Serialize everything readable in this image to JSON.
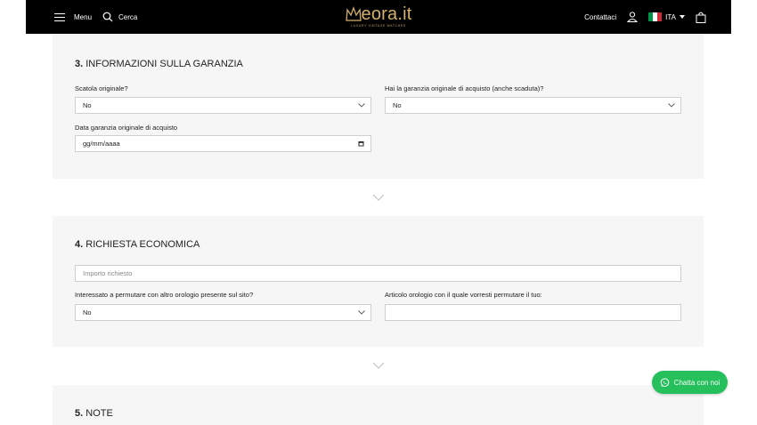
{
  "header": {
    "menu_label": "Menu",
    "search_label": "Cerca",
    "logo_text": "eora.it",
    "logo_tagline": "LUXURY VINTAGE WATCHES",
    "contact_label": "Contattaci",
    "language": "ITA",
    "flag_colors": [
      "#009246",
      "#ffffff",
      "#ce2b37"
    ],
    "logo_color": "#d4b06a"
  },
  "section3": {
    "number": "3.",
    "title": "INFORMAZIONI SULLA GARANZIA",
    "box_label": "Scatola originale?",
    "box_value": "No",
    "warranty_label": "Hai la garanzia originale di acquisto (anche scaduta)?",
    "warranty_value": "No",
    "date_label": "Data garanzia originale di acquisto",
    "date_placeholder": "gg/mm/aaaa"
  },
  "section4": {
    "number": "4.",
    "title": "RICHIESTA ECONOMICA",
    "amount_placeholder": "Importo richiesto",
    "exchange_label": "Interessato a permutare con altro orologio presente sul sito?",
    "exchange_value": "No",
    "article_label": "Articolo orologio con il quale vorresti permutare il tuo:",
    "article_value": ""
  },
  "section5": {
    "number": "5.",
    "title": "NOTE"
  },
  "chat": {
    "label": "Chatta con noi",
    "color": "#25c05b"
  }
}
